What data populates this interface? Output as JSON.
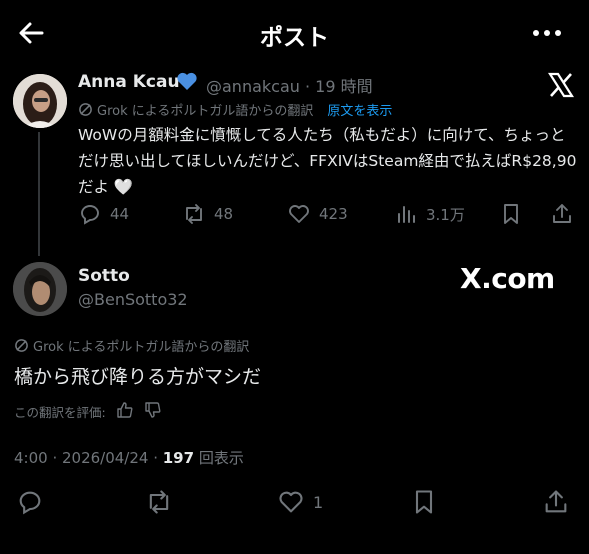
{
  "header": {
    "title": "ポスト",
    "back_icon": "arrow-left-icon",
    "more_icon": "more-dots-icon"
  },
  "parent": {
    "name": "Anna Kcau",
    "verified_icon": "blue-heart-icon",
    "handle_time": "@annakcau · 19 時間",
    "translation_note": "Grok によるポルトガル語からの翻訳",
    "show_original": "原文を表示",
    "text": "WoWの月額料金に憤慨してる人たち（私もだよ）に向けて、ちょっとだけ思い出してほしいんだけど、FFXIVはSteam経由で払えばR$28,90だよ 🤍",
    "replies": "44",
    "reposts": "48",
    "likes": "423",
    "views": "3.1万"
  },
  "reply": {
    "name": "Sotto",
    "handle": "@BenSotto32",
    "watermark": "X.com",
    "translation_note": "Grok によるポルトガル語からの翻訳",
    "text": "橋から飛び降りる方がマシだ",
    "rate_label": "この翻訳を評価:",
    "meta_prefix": "4:00 · 2026/04/24 · ",
    "views_count": "197",
    "views_suffix": " 回表示",
    "likes": "1"
  },
  "colors": {
    "background": "#000000",
    "text": "#e7e9ea",
    "muted": "#71767b",
    "link": "#1d9bf0",
    "heart": "#1d9bf0"
  }
}
